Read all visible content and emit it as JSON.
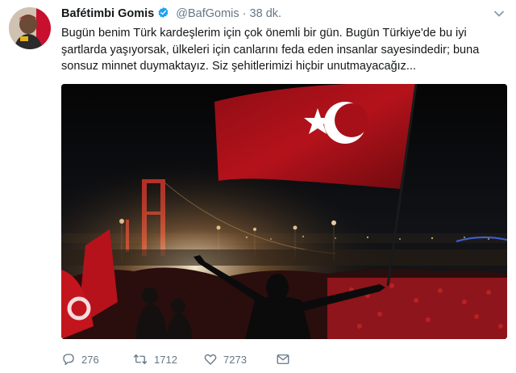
{
  "tweet": {
    "author_name": "Bafétimbi Gomis",
    "handle": "@BafGomis",
    "separator": "·",
    "time": "38 dk.",
    "text_line1": "Bugün benim Türk kardeşlerim için çok önemli bir gün. Bugün Türkiye'de bu iyi",
    "text_line2": "şartlarda yaşıyorsak, ülkeleri için canlarını feda eden insanlar sayesindedir; buna",
    "text_line3": "sonsuz minnet duymaktayız. Siz şehitlerimizi hiçbir unutmayacağız...",
    "reply_count": "276",
    "retweet_count": "1712",
    "like_count": "7273"
  },
  "colors": {
    "text": "#14171a",
    "secondary": "#657786",
    "verified": "#1da1f2",
    "flag_red": "#b5121b"
  },
  "icons": {
    "verified": "verified-badge-icon",
    "caret": "chevron-down-icon",
    "reply": "reply-icon",
    "retweet": "retweet-icon",
    "like": "heart-icon",
    "dm": "envelope-icon"
  }
}
